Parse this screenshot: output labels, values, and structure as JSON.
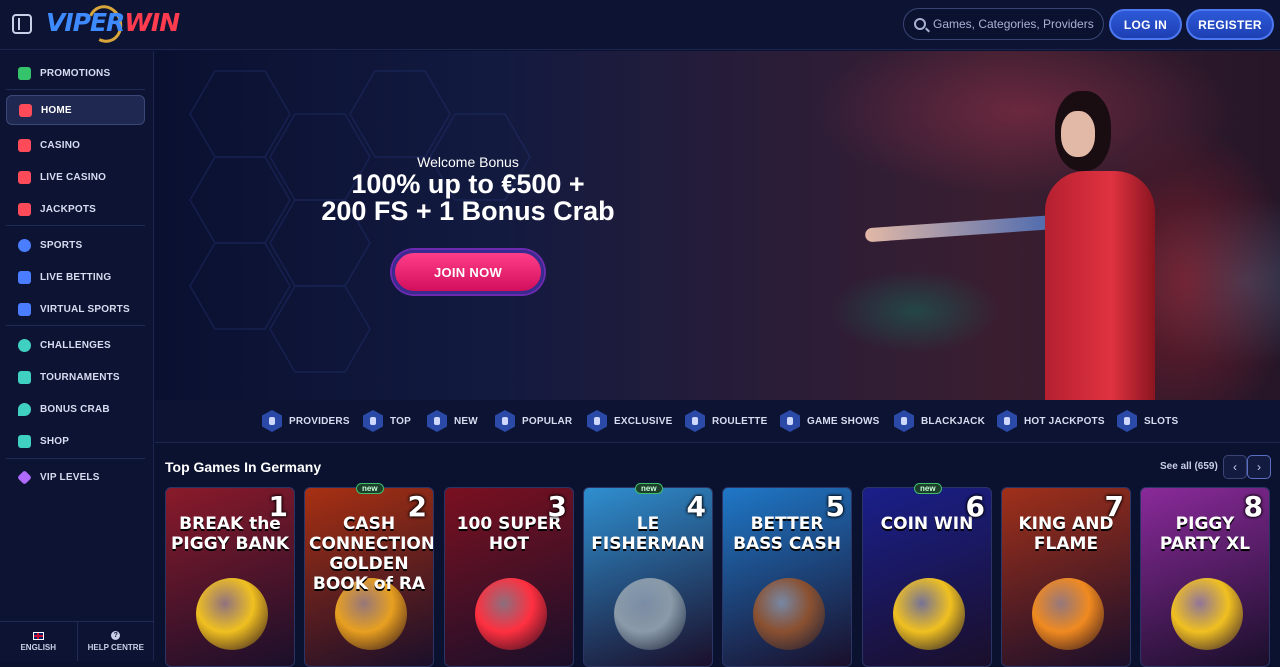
{
  "header": {
    "logo_viper": "VIPER",
    "logo_win": "WIN",
    "search_placeholder": "Games, Categories, Providers",
    "login_label": "LOG IN",
    "register_label": "REGISTER"
  },
  "sidebar": {
    "items": [
      {
        "label": "PROMOTIONS",
        "icon": "gift-icon",
        "color": "#35c46b"
      },
      {
        "label": "HOME",
        "icon": "home-icon",
        "color": "#ff4a5a"
      },
      {
        "label": "CASINO",
        "icon": "slot-machine-icon",
        "color": "#ff4a5a"
      },
      {
        "label": "LIVE CASINO",
        "icon": "phone-icon",
        "color": "#ff4a5a"
      },
      {
        "label": "JACKPOTS",
        "icon": "cherries-icon",
        "color": "#ff4a5a"
      },
      {
        "label": "SPORTS",
        "icon": "ball-icon",
        "color": "#4a7dff"
      },
      {
        "label": "LIVE BETTING",
        "icon": "scoreboard-icon",
        "color": "#4a7dff"
      },
      {
        "label": "VIRTUAL SPORTS",
        "icon": "gamepad-icon",
        "color": "#4a7dff"
      },
      {
        "label": "CHALLENGES",
        "icon": "medal-icon",
        "color": "#3fd0c0"
      },
      {
        "label": "TOURNAMENTS",
        "icon": "trophy-icon",
        "color": "#3fd0c0"
      },
      {
        "label": "BONUS CRAB",
        "icon": "crab-claw-icon",
        "color": "#3fd0c0"
      },
      {
        "label": "SHOP",
        "icon": "shopping-bag-icon",
        "color": "#3fd0c0"
      },
      {
        "label": "VIP LEVELS",
        "icon": "diamond-icon",
        "color": "#b06aff"
      }
    ],
    "footer": {
      "language_label": "ENGLISH",
      "help_label": "HELP CENTRE"
    }
  },
  "hero": {
    "subtitle": "Welcome Bonus",
    "title_line1": "100% up to €500 +",
    "title_line2": "200 FS + 1 Bonus Crab",
    "cta_label": "JOIN NOW"
  },
  "categories": [
    {
      "label": "PROVIDERS",
      "icon": "providers-icon"
    },
    {
      "label": "TOP",
      "icon": "star-icon"
    },
    {
      "label": "NEW",
      "icon": "new-icon"
    },
    {
      "label": "POPULAR",
      "icon": "flame-icon"
    },
    {
      "label": "EXCLUSIVE",
      "icon": "gem-icon"
    },
    {
      "label": "ROULETTE",
      "icon": "roulette-icon"
    },
    {
      "label": "GAME SHOWS",
      "icon": "game-shows-icon"
    },
    {
      "label": "BLACKJACK",
      "icon": "cards-icon"
    },
    {
      "label": "HOT JACKPOTS",
      "icon": "hot-jackpot-icon"
    },
    {
      "label": "SLOTS",
      "icon": "slots-icon"
    }
  ],
  "top_games": {
    "title": "Top Games In Germany",
    "see_all": "See all (659)",
    "new_badge": "new",
    "games": [
      {
        "rank": "1",
        "title": "BREAK the PIGGY BANK",
        "bg": "#8a1a2a",
        "art": "#f0c020",
        "new": false
      },
      {
        "rank": "2",
        "title": "CASH CONNECTION GOLDEN BOOK of RA",
        "bg": "#a83012",
        "art": "#e8a020",
        "new": true
      },
      {
        "rank": "3",
        "title": "100 SUPER HOT",
        "bg": "#7a1020",
        "art": "#ff3040",
        "new": false
      },
      {
        "rank": "4",
        "title": "LE FISHERMAN",
        "bg": "#2f8fd0",
        "art": "#8a9aa8",
        "new": true
      },
      {
        "rank": "5",
        "title": "BETTER BASS CASH",
        "bg": "#1f78c8",
        "art": "#8a5030",
        "new": false
      },
      {
        "rank": "6",
        "title": "COIN WIN",
        "bg": "#1a1f8a",
        "art": "#f0c020",
        "new": true
      },
      {
        "rank": "7",
        "title": "KING AND FLAME",
        "bg": "#a0301a",
        "art": "#f08a20",
        "new": false
      },
      {
        "rank": "8",
        "title": "PIGGY PARTY XL",
        "bg": "#8a2a9a",
        "art": "#f0c020",
        "new": false
      }
    ]
  }
}
